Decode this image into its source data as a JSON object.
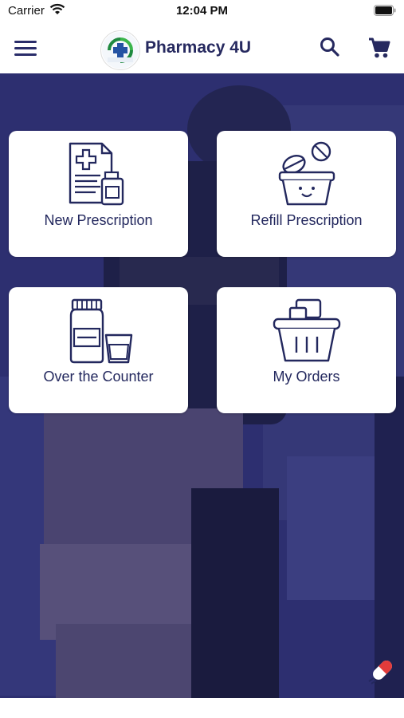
{
  "status_bar": {
    "carrier": "Carrier",
    "time": "12:04 PM"
  },
  "header": {
    "app_title": "Pharmacy 4U",
    "logo_text": "PHARMACY 4U"
  },
  "tiles": [
    {
      "label": "New Prescription",
      "icon": "prescription-document-icon"
    },
    {
      "label": "Refill Prescription",
      "icon": "pill-basket-icon"
    },
    {
      "label": "Over the Counter",
      "icon": "medicine-bottle-icon"
    },
    {
      "label": "My Orders",
      "icon": "shopping-basket-icon"
    }
  ],
  "colors": {
    "brand": "#26295f",
    "overlay": "#2c2e6e",
    "accent": "#e23b3b"
  }
}
